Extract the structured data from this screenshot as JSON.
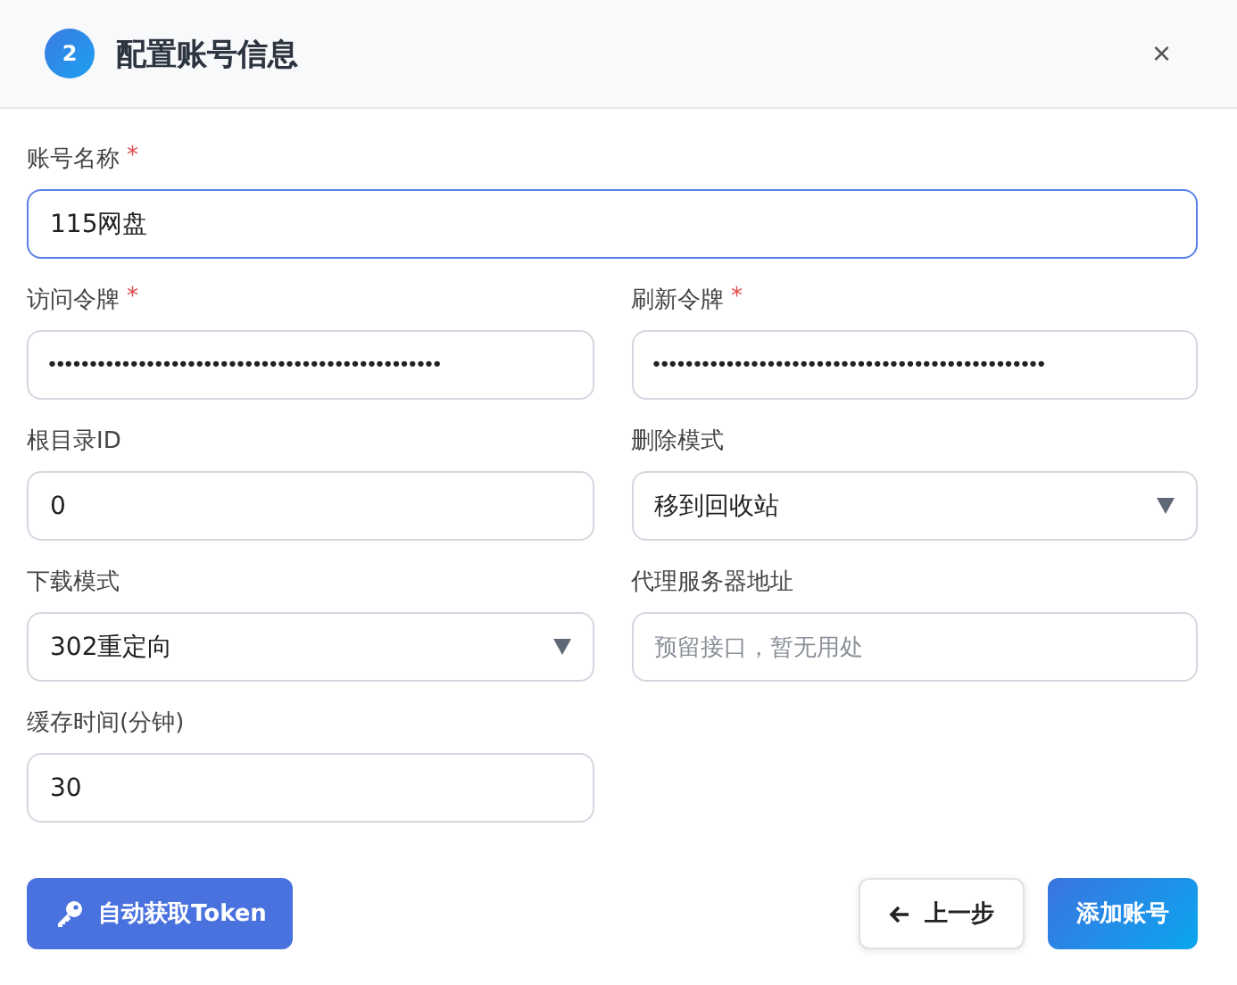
{
  "header": {
    "step": "2",
    "title": "配置账号信息",
    "close": "×"
  },
  "name_field": {
    "label": "账号名称",
    "required_mark": "*",
    "value": "115网盘",
    "focused": true
  },
  "fields": [
    {
      "label": "访问令牌",
      "required_mark": "*",
      "kind": "password",
      "value": "••••••••••••••••••••••••••••••••••••••••••••••••"
    },
    {
      "label": "刷新令牌",
      "required_mark": "*",
      "kind": "password",
      "value": "••••••••••••••••••••••••••••••••••••••••••••••••"
    },
    {
      "label": "根目录ID",
      "kind": "text",
      "value": "0"
    },
    {
      "label": "删除模式",
      "kind": "select",
      "value": "移到回收站"
    },
    {
      "label": "下载模式",
      "kind": "select",
      "value": "302重定向"
    },
    {
      "label": "代理服务器地址",
      "kind": "text",
      "placeholder": "预留接口，暂无用处"
    },
    {
      "label": "缓存时间(分钟)",
      "kind": "text",
      "value": "30"
    }
  ],
  "footer": {
    "token_button": "自动获取Token",
    "back_button": "上一步",
    "submit_button": "添加账号"
  }
}
